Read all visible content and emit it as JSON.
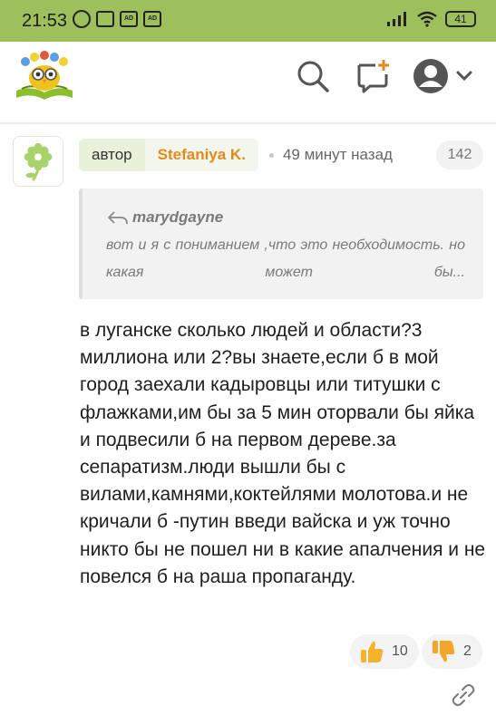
{
  "status_bar": {
    "time": "21:53",
    "badge_ad": "AD",
    "battery": "41"
  },
  "header": {
    "logo_icon": "owl-on-book-logo",
    "search_icon": "search-icon",
    "new_post_icon": "new-comment-icon",
    "profile_icon": "user-avatar-icon",
    "accent": "#e58a1a",
    "bar_color": "#9ec05c"
  },
  "post": {
    "author_label": "автор",
    "author_name": "Stefaniya K.",
    "time_ago": "49 минут назад",
    "reply_count": "142",
    "quote": {
      "user": "marydgayne",
      "text": "вот и я с пониманием ,что это необходимость. но какая может бы..."
    },
    "body": "в луганске сколько людей и области?3 миллиона или 2?вы знаете,если б в мой город заехали кадыровцы или титушки с флажками,им бы за 5 мин оторвали бы яйка и подвесили б на первом дереве.за сепаратизм.люди вышли бы с вилами,камнями,коктейлями молотова.и не кричали б -путин введи вайска и уж точно никто бы не пошел ни в какие апалчения и не повелся б на раша пропаганду.",
    "likes": "10",
    "dislikes": "2"
  }
}
